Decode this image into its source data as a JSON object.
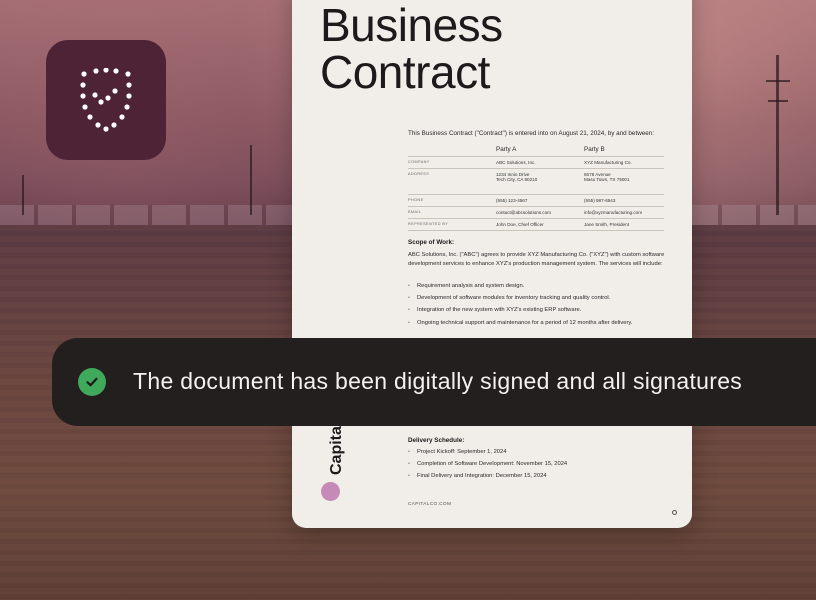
{
  "app": {
    "icon_name": "shield-check-icon",
    "icon_bg_color": "#4e2336"
  },
  "document": {
    "title_line1": "Business",
    "title_line2": "Contract",
    "intro": "This Business Contract (\"Contract\") is entered into on August 21, 2024, by and between:",
    "party_a_header": "Party A",
    "party_b_header": "Party B",
    "rows": [
      {
        "label": "COMPANY",
        "a": "ABC Solutions, Inc.",
        "b": "XYZ Manufacturing Co."
      },
      {
        "label": "ADDRESS",
        "a": "1234 Innio Drive\nTech City, CA 90210",
        "b": "5678 Avenue\nMasu Town, TX 75001"
      },
      {
        "label": "PHONE",
        "a": "(555) 123-4567",
        "b": "(555) 987-6543"
      },
      {
        "label": "EMAIL",
        "a": "contact@abcsolutions.com",
        "b": "info@xyzmanufacturing.com"
      },
      {
        "label": "REPRESENTED BY",
        "a": "John Doe, Chief Officer",
        "b": "Jane Smith, President"
      }
    ],
    "scope_heading": "Scope of Work:",
    "scope_text": "ABC Solutions, Inc. (\"ABC\") agrees to provide XYZ Manufacturing Co. (\"XYZ\") with custom software development services to enhance XYZ's production management system. The services will include:",
    "scope_items": [
      "Requirement analysis and system design.",
      "Development of software modules for inventory tracking and quality control.",
      "Integration of the new system with XYZ's existing ERP software.",
      "Ongoing technical support and maintenance for a period of 12 months after delivery."
    ],
    "delivery_heading": "Delivery Schedule:",
    "delivery_items": [
      "Project Kickoff: September 1, 2024",
      "Completion of Software Development: November 15, 2024",
      "Final Delivery and Integration: December 15, 2024"
    ],
    "brand_name": "Capital",
    "brand_color": "#c68ab8",
    "footer_url": "CAPITALCO.COM"
  },
  "toast": {
    "message": "The document has been digitally signed and all signatures",
    "icon_name": "check-circle-icon",
    "icon_color": "#3fa95c"
  }
}
